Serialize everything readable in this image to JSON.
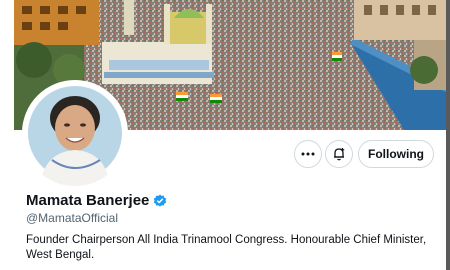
{
  "profile": {
    "banner_image": "crowd-rally-photo",
    "avatar_image": "profile-photo",
    "name": "Mamata Banerjee",
    "verified": true,
    "handle": "@MamataOfficial",
    "bio": "Founder Chairperson All India Trinamool Congress. Honourable Chief Minister, West Bengal."
  },
  "actions": {
    "more_icon": "more-icon",
    "notify_icon": "notification-bell-icon",
    "follow_label": "Following"
  },
  "colors": {
    "verified_badge": "#1d9bf0",
    "button_border": "#cfd9de",
    "handle_text": "#536471"
  }
}
